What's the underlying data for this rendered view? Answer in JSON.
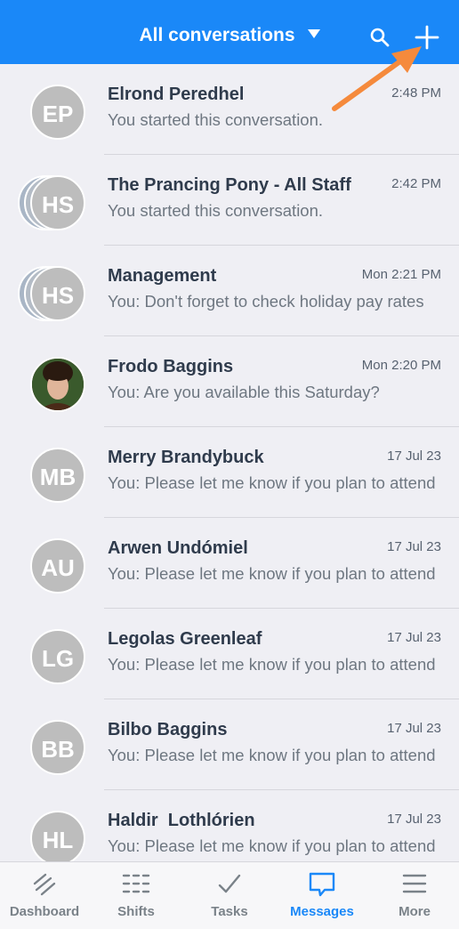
{
  "header": {
    "title": "All conversations",
    "search_icon": "search-icon",
    "add_icon": "plus-icon",
    "bg_color": "#1a88f8"
  },
  "conversations": [
    {
      "name": "Elrond Peredhel",
      "initials": "EP",
      "time": "2:48 PM",
      "preview": "You started this conversation.",
      "group": false
    },
    {
      "name": "The Prancing Pony - All Staff",
      "initials": "HS",
      "time": "2:42 PM",
      "preview": "You started this conversation.",
      "group": true
    },
    {
      "name": "Management",
      "initials": "HS",
      "time": "Mon 2:21 PM",
      "preview": "You: Don't forget to check holiday pay rates",
      "group": true
    },
    {
      "name": "Frodo Baggins",
      "initials": "",
      "time": "Mon 2:20 PM",
      "preview": "You: Are you available this Saturday?",
      "group": false,
      "photo": true
    },
    {
      "name": "Merry Brandybuck",
      "initials": "MB",
      "time": "17 Jul 23",
      "preview": "You: Please let me know if you plan to attend",
      "group": false
    },
    {
      "name": "Arwen Undómiel",
      "initials": "AU",
      "time": "17 Jul 23",
      "preview": "You: Please let me know if you plan to attend",
      "group": false
    },
    {
      "name": "Legolas Greenleaf",
      "initials": "LG",
      "time": "17 Jul 23",
      "preview": "You: Please let me know if you plan to attend",
      "group": false
    },
    {
      "name": "Bilbo Baggins",
      "initials": "BB",
      "time": "17 Jul 23",
      "preview": "You: Please let me know if you plan to attend",
      "group": false
    },
    {
      "name": "Haldir  Lothlórien",
      "initials": "HL",
      "time": "17 Jul 23",
      "preview": "You: Please let me know if you plan to attend",
      "group": false
    }
  ],
  "tabbar": {
    "tabs": [
      {
        "label": "Dashboard",
        "icon": "dashboard-icon"
      },
      {
        "label": "Shifts",
        "icon": "shifts-icon"
      },
      {
        "label": "Tasks",
        "icon": "checkmark-icon"
      },
      {
        "label": "Messages",
        "icon": "chat-bubble-icon",
        "active": true
      },
      {
        "label": "More",
        "icon": "hamburger-icon"
      }
    ],
    "active_color": "#1a88f8"
  }
}
